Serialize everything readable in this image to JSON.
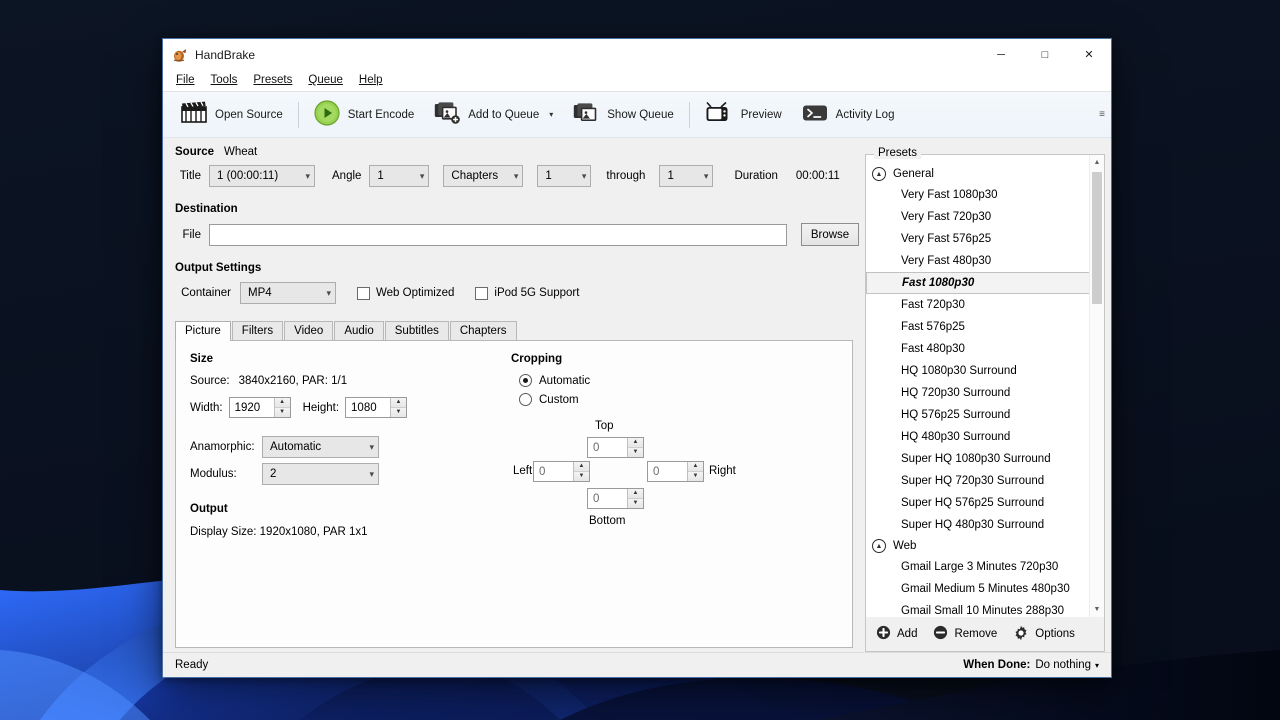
{
  "window": {
    "title": "HandBrake",
    "minimize_label": "─",
    "maximize_label": "□",
    "close_label": "✕"
  },
  "menubar": {
    "items": [
      {
        "label": "File",
        "accel": "F"
      },
      {
        "label": "Tools",
        "accel": "T"
      },
      {
        "label": "Presets",
        "accel": "P"
      },
      {
        "label": "Queue",
        "accel": "Q"
      },
      {
        "label": "Help",
        "accel": "H"
      }
    ]
  },
  "toolbar": {
    "open_source": "Open Source",
    "start_encode": "Start Encode",
    "add_to_queue": "Add to Queue",
    "add_to_queue_caret": "▾",
    "show_queue": "Show Queue",
    "preview": "Preview",
    "activity_log": "Activity Log",
    "overflow_glyph": "≡"
  },
  "source": {
    "heading": "Source",
    "name": "Wheat",
    "title_label": "Title",
    "title_value": "1 (00:00:11)",
    "angle_label": "Angle",
    "angle_value": "1",
    "chapters_label": "Chapters",
    "chapter_start": "1",
    "through_label": "through",
    "chapter_end": "1",
    "duration_label": "Duration",
    "duration_value": "00:00:11"
  },
  "destination": {
    "heading": "Destination",
    "file_label": "File",
    "file_value": "",
    "file_placeholder": "",
    "browse_label": "Browse"
  },
  "output_settings": {
    "heading": "Output Settings",
    "container_label": "Container",
    "container_value": "MP4",
    "web_optimized_label": "Web Optimized",
    "web_optimized_checked": false,
    "ipod_label": "iPod 5G Support",
    "ipod_checked": false
  },
  "tabs": {
    "items": [
      "Picture",
      "Filters",
      "Video",
      "Audio",
      "Subtitles",
      "Chapters"
    ],
    "active": "Picture"
  },
  "picture": {
    "size_heading": "Size",
    "source_label": "Source:",
    "source_value": "3840x2160, PAR: 1/1",
    "width_label": "Width:",
    "width_value": "1920",
    "height_label": "Height:",
    "height_value": "1080",
    "anamorphic_label": "Anamorphic:",
    "anamorphic_value": "Automatic",
    "modulus_label": "Modulus:",
    "modulus_value": "2",
    "output_heading": "Output",
    "display_size_text": "Display Size: 1920x1080,  PAR 1x1"
  },
  "cropping": {
    "heading": "Cropping",
    "automatic_label": "Automatic",
    "custom_label": "Custom",
    "mode": "Automatic",
    "top_label": "Top",
    "top_value": "0",
    "left_label": "Left",
    "left_value": "0",
    "right_label": "Right",
    "right_value": "0",
    "bottom_label": "Bottom",
    "bottom_value": "0"
  },
  "presets": {
    "legend": "Presets",
    "selected": "Fast 1080p30",
    "groups": [
      {
        "name": "General",
        "expanded": true,
        "items": [
          "Very Fast 1080p30",
          "Very Fast 720p30",
          "Very Fast 576p25",
          "Very Fast 480p30",
          "Fast 1080p30",
          "Fast 720p30",
          "Fast 576p25",
          "Fast 480p30",
          "HQ 1080p30 Surround",
          "HQ 720p30 Surround",
          "HQ 576p25 Surround",
          "HQ 480p30 Surround",
          "Super HQ 1080p30 Surround",
          "Super HQ 720p30 Surround",
          "Super HQ 576p25 Surround",
          "Super HQ 480p30 Surround"
        ]
      },
      {
        "name": "Web",
        "expanded": true,
        "items": [
          "Gmail Large 3 Minutes 720p30",
          "Gmail Medium 5 Minutes 480p30",
          "Gmail Small 10 Minutes 288p30"
        ]
      }
    ],
    "footer": {
      "add_label": "Add",
      "remove_label": "Remove",
      "options_label": "Options"
    }
  },
  "statusbar": {
    "status": "Ready",
    "when_done_label": "When Done:",
    "when_done_value": "Do nothing",
    "when_done_caret": "▾"
  },
  "colors": {
    "accent_blue": "#4a9bdc",
    "toolbar_bg": "#eef4fa",
    "window_bg": "#f0f0f0",
    "encode_green": "#7dc242"
  }
}
